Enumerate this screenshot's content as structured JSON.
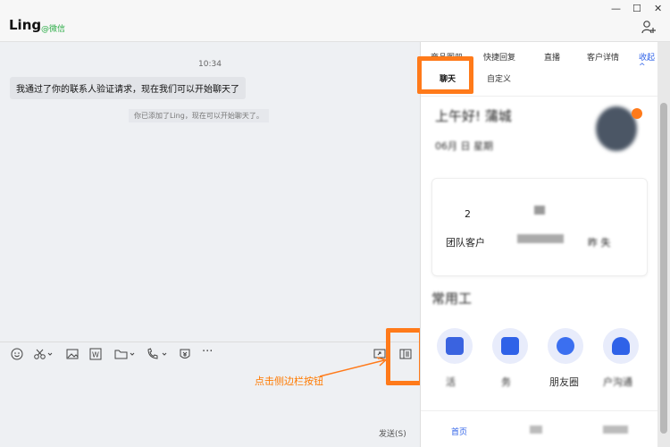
{
  "header": {
    "title": "Ling",
    "subtitle": "@微信",
    "window_controls": [
      "—",
      "☐",
      "✕"
    ]
  },
  "chat": {
    "timestamp": "10:34",
    "message": "我通过了你的联系人验证请求，现在我们可以开始聊天了",
    "system_notice": "你已添加了Ling，现在可以开始聊天了。"
  },
  "composer": {
    "send_label": "发送(S)",
    "annotation": "点击侧边栏按钮"
  },
  "sidebar": {
    "tabs_row1": [
      "商品图册",
      "快捷回复",
      "直播",
      "客户详情",
      "收起 ^"
    ],
    "tabs_row2": [
      "聊天",
      "自定义"
    ],
    "greeting": "上午好! 蒲城",
    "date": "06月 日  星期",
    "stats": [
      {
        "value": "2",
        "label": "团队客户"
      },
      {
        "value": "",
        "label": ""
      },
      {
        "value": "",
        "label": "昨 失"
      }
    ],
    "tools_title": "常用工",
    "tools": [
      "活",
      "务",
      "朋友圈",
      "户沟通"
    ],
    "bottom_nav": [
      "首页",
      "",
      ""
    ]
  },
  "colors": {
    "highlight": "#ff7a1a",
    "hint_text": "#ff7a00",
    "accent_blue": "#3a63e0",
    "wechat_green": "#2fae4a"
  }
}
